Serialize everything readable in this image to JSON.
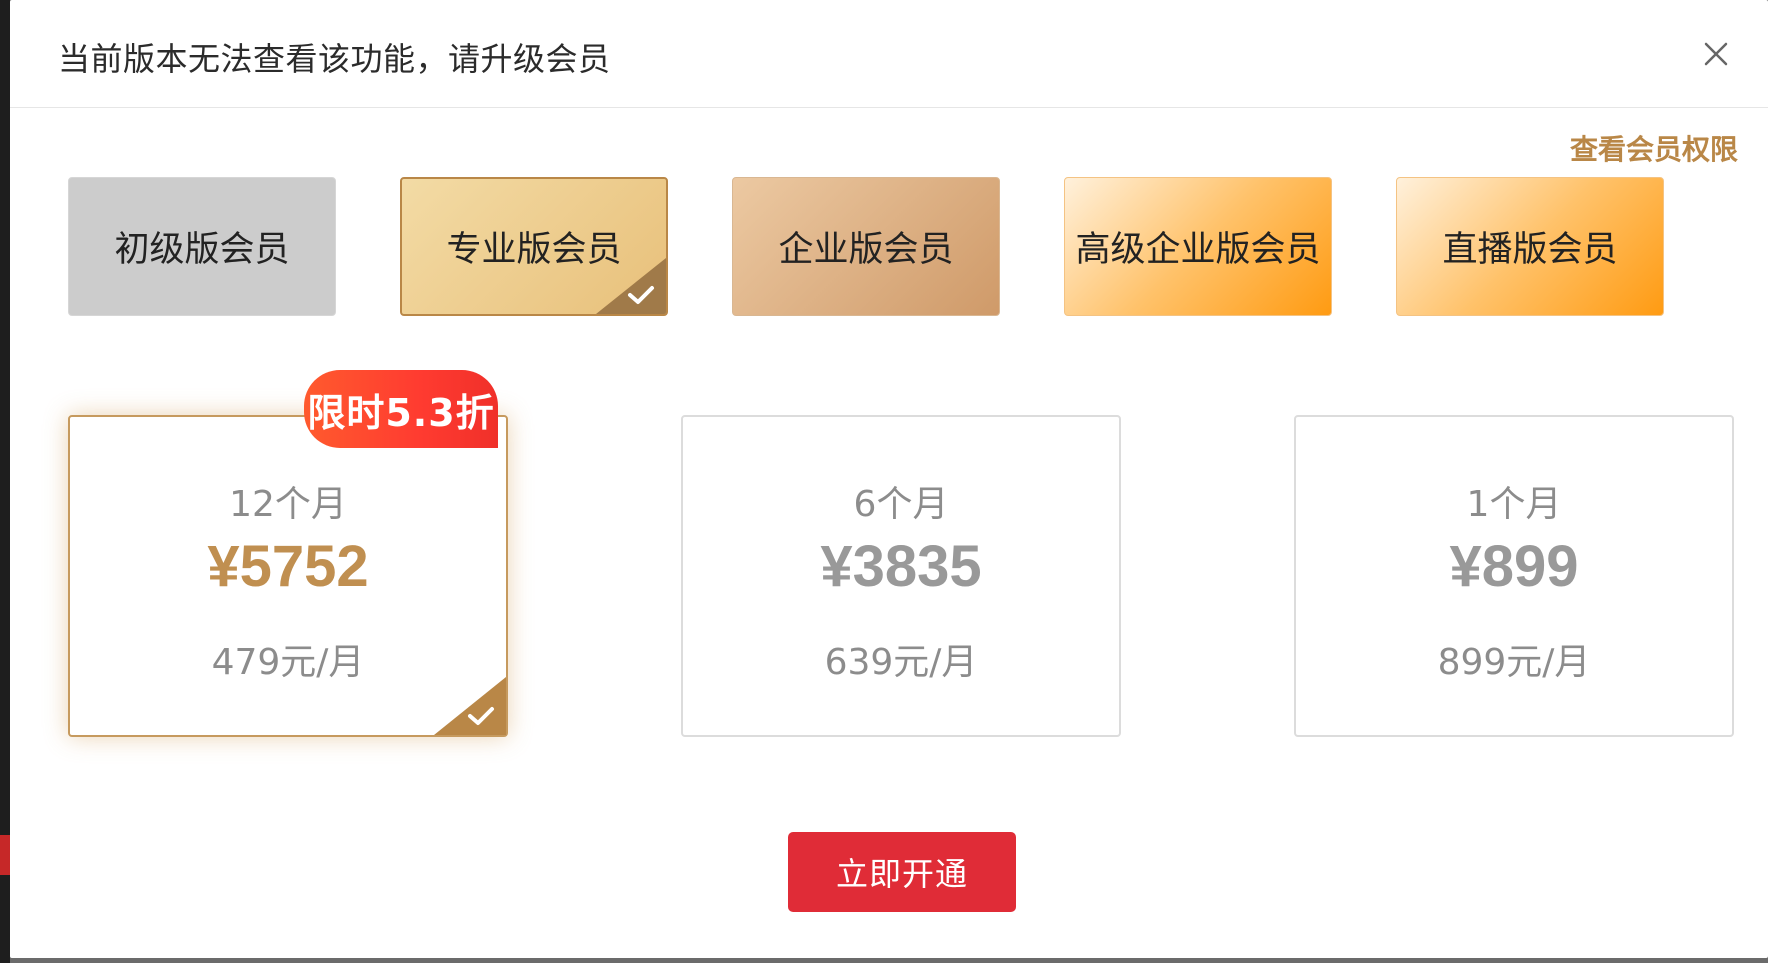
{
  "dialog": {
    "title": "当前版本无法查看该功能，请升级会员",
    "close_label": "×",
    "rights_link": "查看会员权限"
  },
  "tiers": [
    {
      "label": "初级版会员",
      "selected": false
    },
    {
      "label": "专业版会员",
      "selected": true
    },
    {
      "label": "企业版会员",
      "selected": false
    },
    {
      "label": "高级企业版会员",
      "selected": false
    },
    {
      "label": "直播版会员",
      "selected": false
    }
  ],
  "plans": [
    {
      "duration": "12个月",
      "price": "¥5752",
      "monthly": "479元/月",
      "badge": "限时5.3折",
      "selected": true
    },
    {
      "duration": "6个月",
      "price": "¥3835",
      "monthly": "639元/月",
      "selected": false
    },
    {
      "duration": "1个月",
      "price": "¥899",
      "monthly": "899元/月",
      "selected": false
    }
  ],
  "actions": {
    "activate_label": "立即开通"
  },
  "colors": {
    "accent_gold": "#b98747",
    "price_gold": "#c08f50",
    "button_red": "#e02c37",
    "badge_red": "#ff3b30"
  }
}
